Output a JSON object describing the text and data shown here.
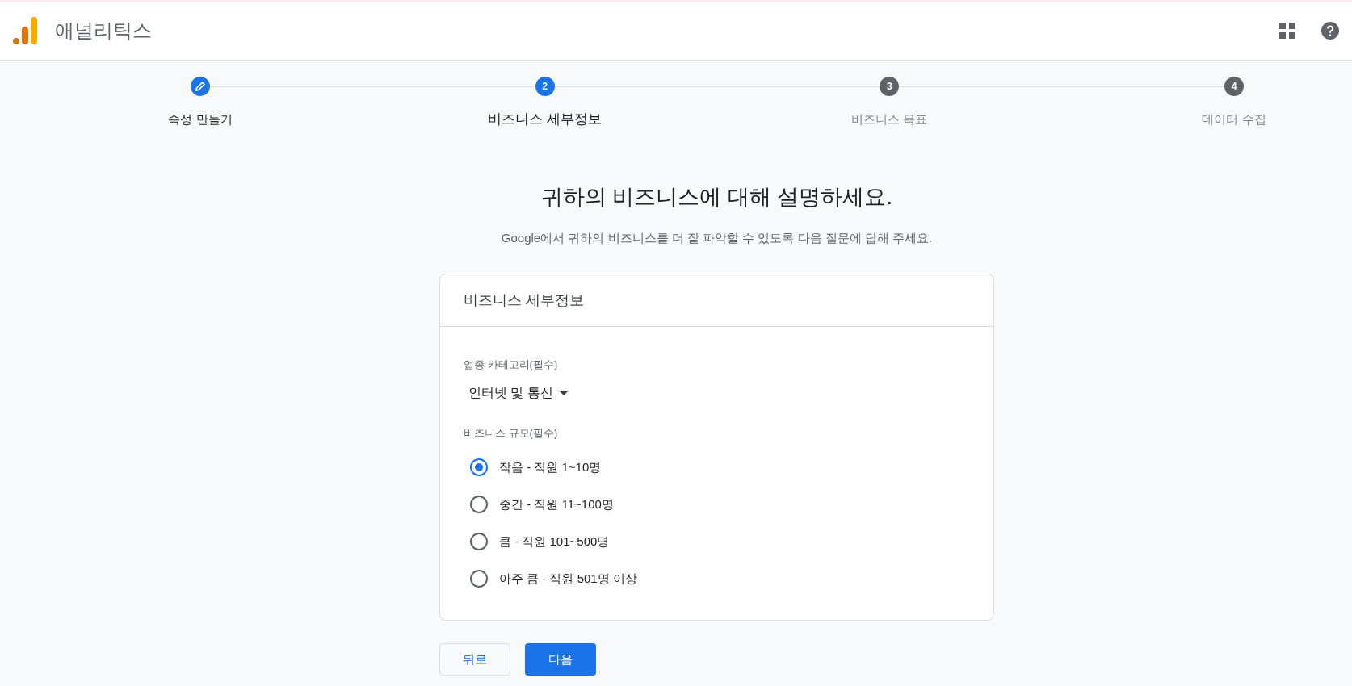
{
  "app": {
    "title": "애널리틱스"
  },
  "steps": [
    {
      "label": "속성 만들기",
      "completed": true,
      "selected": false
    },
    {
      "label": "비즈니스 세부정보",
      "completed": false,
      "selected": true,
      "number": "2"
    },
    {
      "label": "비즈니스 목표",
      "completed": false,
      "selected": false,
      "number": "3"
    },
    {
      "label": "데이터 수집",
      "completed": false,
      "selected": false,
      "number": "4"
    }
  ],
  "heading": "귀하의 비즈니스에 대해 설명하세요.",
  "description": "Google에서 귀하의 비즈니스를 더 잘 파악할 수 있도록 다음 질문에 답해 주세요.",
  "card": {
    "title": "비즈니스 세부정보",
    "industry": {
      "label": "업종 카테고리(필수)",
      "value": "인터넷 및 통신"
    },
    "size": {
      "label": "비즈니스 규모(필수)",
      "options": [
        {
          "label": "작음 - 직원 1~10명",
          "selected": true
        },
        {
          "label": "중간 - 직원 11~100명",
          "selected": false
        },
        {
          "label": "큼 - 직원 101~500명",
          "selected": false
        },
        {
          "label": "아주 큼 - 직원 501명 이상",
          "selected": false
        }
      ]
    }
  },
  "buttons": {
    "back": "뒤로",
    "next": "다음"
  }
}
